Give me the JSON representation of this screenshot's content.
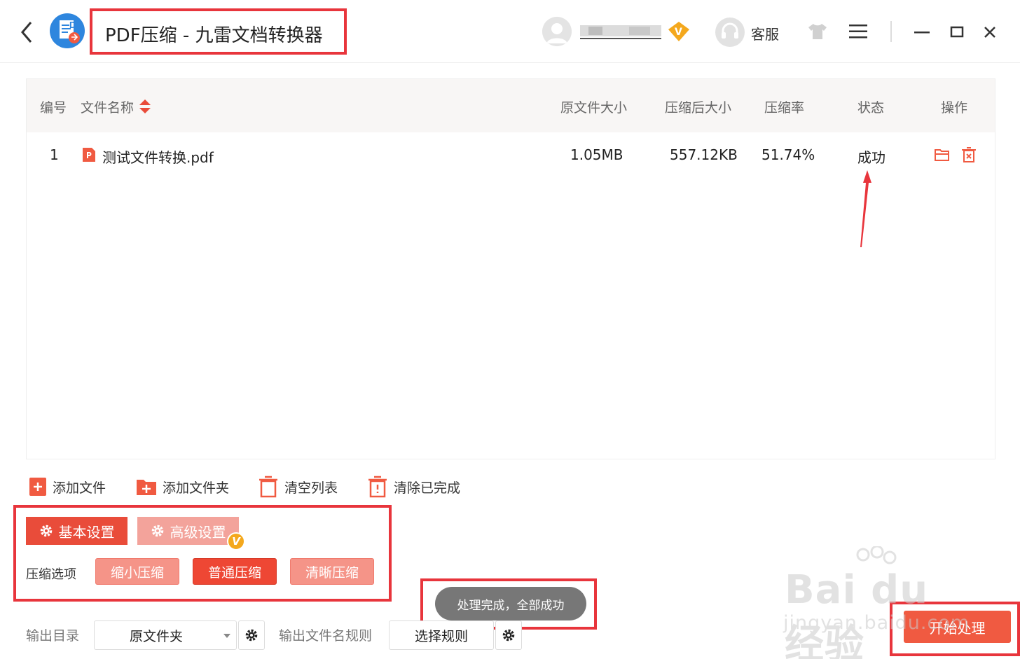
{
  "titlebar": {
    "title": "PDF压缩 - 九雷文档转换器",
    "support_label": "客服",
    "vip_mark": "V"
  },
  "table": {
    "headers": {
      "index": "编号",
      "file_name": "文件名称",
      "original_size": "原文件大小",
      "compressed_size": "压缩后大小",
      "ratio": "压缩率",
      "status": "状态",
      "actions": "操作"
    },
    "rows": [
      {
        "index": "1",
        "file_name": "测试文件转换.pdf",
        "original_size": "1.05MB",
        "compressed_size": "557.12KB",
        "ratio": "51.74%",
        "status": "成功"
      }
    ]
  },
  "actions": {
    "add_file": "添加文件",
    "add_folder": "添加文件夹",
    "clear_list": "清空列表",
    "clear_done": "清除已完成"
  },
  "settings": {
    "tab_basic": "基本设置",
    "tab_advanced": "高级设置",
    "vip_mark": "V",
    "compress_label": "压缩选项",
    "options": [
      "缩小压缩",
      "普通压缩",
      "清晰压缩"
    ],
    "selected_option": "普通压缩"
  },
  "toast": "处理完成，全部成功",
  "output": {
    "dir_label": "输出目录",
    "dir_value": "原文件夹",
    "rule_label": "输出文件名规则",
    "rule_button": "选择规则"
  },
  "start_button": "开始处理",
  "watermark": {
    "word": "Bai du 经验",
    "url": "jingyan.baidu.com"
  },
  "colors": {
    "accent": "#e94c3a",
    "annotation": "#e8353c",
    "vip": "#f4a81d"
  }
}
